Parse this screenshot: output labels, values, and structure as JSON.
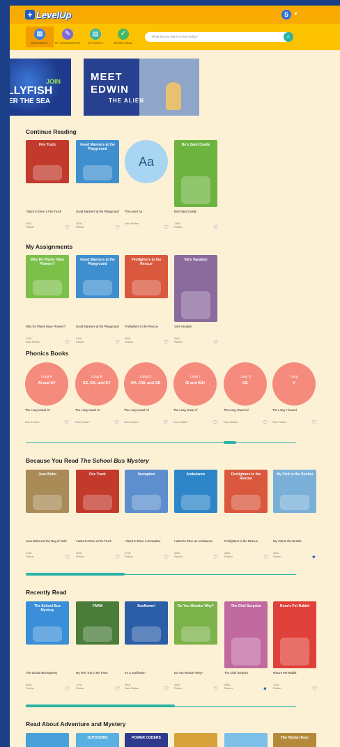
{
  "app": {
    "logo": "LevelUp",
    "avatar": "S"
  },
  "nav": [
    {
      "label": "BOOKSHELF",
      "color": "#3d7fe0",
      "active": true
    },
    {
      "label": "MY ASSIGNMENTS",
      "color": "#7e6ad8",
      "active": false
    },
    {
      "label": "MY BOOKS",
      "color": "#3bb3a0",
      "active": false
    },
    {
      "label": "BOOKS READ",
      "color": "#47b863",
      "active": false
    }
  ],
  "search": {
    "placeholder": "What do you want to read today?"
  },
  "banners": [
    {
      "line1": "JOIN",
      "line2": "LLYFISH",
      "line3": "ER THE SEA"
    },
    {
      "line1": "MEET",
      "line2": "EDWIN",
      "line3": "THE ALIEN"
    }
  ],
  "sections": {
    "continue": {
      "title": "Continue Reading",
      "books": [
        {
          "title": "I Want to Drive a Fire Truck",
          "level": "400L",
          "genre": "Fiction",
          "cover": "#c23a2c",
          "cover_text": "Fire Truck"
        },
        {
          "title": "Good Manners at the Playground",
          "level": "340L",
          "genre": "Fiction",
          "cover": "#3f8fcf",
          "cover_text": "Good Manners at the Playground"
        },
        {
          "title": "The Letter Aa",
          "level": "",
          "genre": "Non-Fiction",
          "cover": "aa",
          "cover_text": "Aa"
        },
        {
          "title": "Bo's Sand Castle",
          "level": "130L",
          "genre": "Fiction",
          "cover": "#6db33f",
          "cover_text": "Bo's Sand Castle"
        }
      ]
    },
    "assignments": {
      "title": "My Assignments",
      "books": [
        {
          "title": "Why Do Plants Have Flowers?",
          "level": "410L",
          "genre": "Non-Fiction",
          "cover": "#7cc04a",
          "cover_text": "Why Do Plants Have Flowers?"
        },
        {
          "title": "Good Manners at the Playground",
          "level": "340L",
          "genre": "Fiction",
          "cover": "#3f8fcf",
          "cover_text": "Good Manners at the Playground"
        },
        {
          "title": "Firefighters to the Rescue",
          "level": "300L",
          "genre": "Fiction",
          "cover": "#d9583e",
          "cover_text": "Firefighters to the Rescue"
        },
        {
          "title": "Val's Vacation",
          "level": "310L",
          "genre": "Fiction",
          "cover": "#8b6a9e",
          "cover_text": "Val's Vacation"
        }
      ]
    },
    "phonics": {
      "title": "Phonics Books",
      "books": [
        {
          "title": "The Long Vowel /a/",
          "genre": "Non-Fiction",
          "l1": "Long A",
          "l2": "AI and AY"
        },
        {
          "title": "The Long Vowel /e/",
          "genre": "Non-Fiction",
          "l1": "Long E",
          "l2": "EE, EA, and EY"
        },
        {
          "title": "The Long Vowel /o/",
          "genre": "Non-Fiction",
          "l1": "Long O",
          "l2": "OA, OW, and OE"
        },
        {
          "title": "The Long Vowel /i/",
          "genre": "Non-Fiction",
          "l1": "Long I",
          "l2": "IE and IGH"
        },
        {
          "title": "The Long Vowel /u/",
          "genre": "Non-Fiction",
          "l1": "Long U",
          "l2": "UE"
        },
        {
          "title": "The Long Y Sound",
          "genre": "Non-Fiction",
          "l1": "Long",
          "l2": "Y"
        }
      ]
    },
    "because": {
      "title_prefix": "Because You Read ",
      "title_italic": "The School Bus Mystery",
      "books": [
        {
          "title": "Juan Bobo and the Bag of Gold",
          "level": "470L",
          "genre": "Fiction",
          "cover": "#a88b57",
          "cover_text": "Juan Bobo"
        },
        {
          "title": "I Want to Drive a Fire Truck",
          "level": "400L",
          "genre": "Fiction",
          "cover": "#c23a2c",
          "cover_text": "Fire Truck"
        },
        {
          "title": "I Want to Drive a Snowplow",
          "level": "270L",
          "genre": "Fiction",
          "cover": "#5d8fcf",
          "cover_text": "Snowplow"
        },
        {
          "title": "I Want to Drive an Ambulance",
          "level": "330L",
          "genre": "Fiction",
          "cover": "#2e86c8",
          "cover_text": "Ambulance"
        },
        {
          "title": "Firefighters to the Rescue",
          "level": "300L",
          "genre": "Fiction",
          "cover": "#d9583e",
          "cover_text": "Firefighters to the Rescue"
        },
        {
          "title": "My Visit to the Dentist",
          "level": "300L",
          "genre": "Fiction",
          "cover": "#7ab0d8",
          "cover_text": "My Visit to the Dentist"
        }
      ]
    },
    "recent": {
      "title": "Recently Read",
      "books": [
        {
          "title": "The School Bus Mystery",
          "level": "340L",
          "genre": "Fiction",
          "cover": "#3a8fd8",
          "cover_text": "The School Bus Mystery"
        },
        {
          "title": "My First Trip to the Farm",
          "level": "270L",
          "genre": "Fiction",
          "cover": "#4a7d3a",
          "cover_text": "FARM"
        },
        {
          "title": "It's a Sunflower!",
          "level": "390L",
          "genre": "Non-Fiction",
          "cover": "#2c5ea8",
          "cover_text": "Sunflower!"
        },
        {
          "title": "Do You Wonder Why?",
          "level": "320L",
          "genre": "Fiction",
          "cover": "#7bb24a",
          "cover_text": "Do You Wonder Why?"
        },
        {
          "title": "The Chef Surprise",
          "level": "280L",
          "genre": "Fiction",
          "cover": "#c06aa0",
          "cover_text": "The Chef Surprise"
        },
        {
          "title": "Rosa's Pet Rabbit",
          "level": "170L",
          "genre": "Fiction",
          "cover": "#e0403a",
          "cover_text": "Rosa's Pet Rabbit"
        }
      ]
    },
    "adventure": {
      "title": "Read About Adventure and Mystery",
      "covers": [
        "#4aa0d8",
        "#5ab0e0",
        "#2e3a8c",
        "#d8a23a",
        "#7cc0e8",
        "#b48a3a"
      ],
      "cover_texts": [
        "",
        "OUTDOORS",
        "POWER CODERS",
        "",
        "",
        "The Hidden Door"
      ]
    }
  }
}
